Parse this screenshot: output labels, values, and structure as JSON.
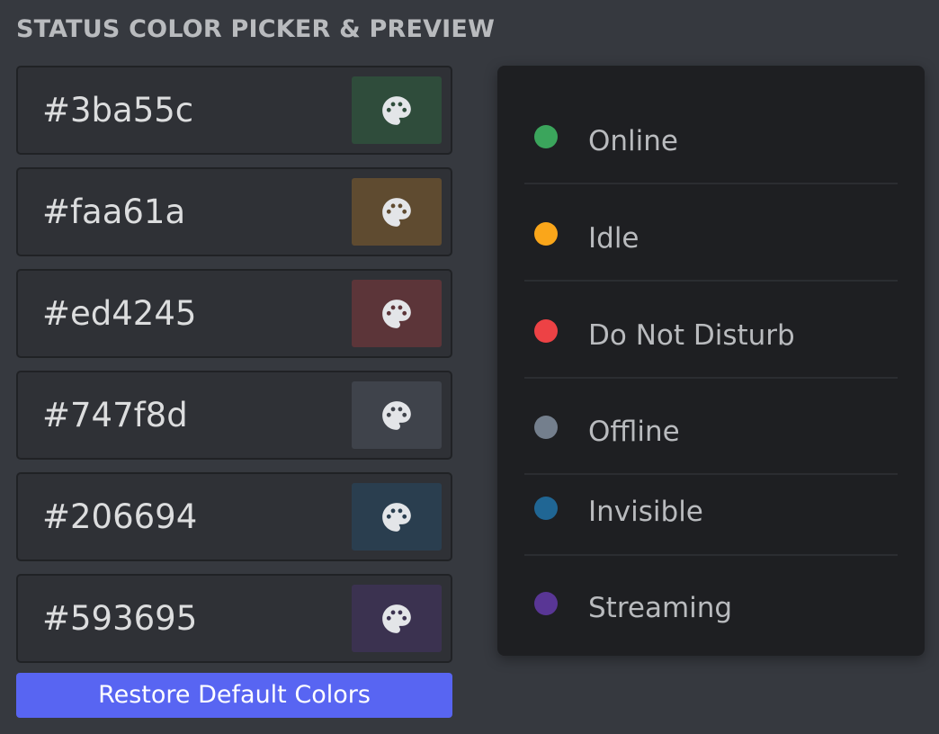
{
  "title": "STATUS COLOR PICKER & PREVIEW",
  "pickers": [
    {
      "hex": "#3ba55c",
      "swatch_bg": "#2f4c3b",
      "icon": "palette-icon"
    },
    {
      "hex": "#faa61a",
      "swatch_bg": "#5f4b30",
      "icon": "palette-icon"
    },
    {
      "hex": "#ed4245",
      "swatch_bg": "#5c3539",
      "icon": "palette-icon"
    },
    {
      "hex": "#747f8d",
      "swatch_bg": "#3f434b",
      "icon": "palette-icon"
    },
    {
      "hex": "#206694",
      "swatch_bg": "#2a3e4f",
      "icon": "palette-icon"
    },
    {
      "hex": "#593695",
      "swatch_bg": "#3b3250",
      "icon": "palette-icon"
    }
  ],
  "restore_label": "Restore Default Colors",
  "statuses": [
    {
      "label": "Online",
      "color": "#3ba55c"
    },
    {
      "label": "Idle",
      "color": "#faa61a"
    },
    {
      "label": "Do Not Disturb",
      "color": "#ed4245"
    },
    {
      "label": "Offline",
      "color": "#747f8d"
    },
    {
      "label": "Invisible",
      "color": "#206694"
    },
    {
      "label": "Streaming",
      "color": "#593695"
    }
  ],
  "colors": {
    "accent": "#5865f2",
    "background": "#36393f",
    "preview_background": "#1e1f22"
  }
}
